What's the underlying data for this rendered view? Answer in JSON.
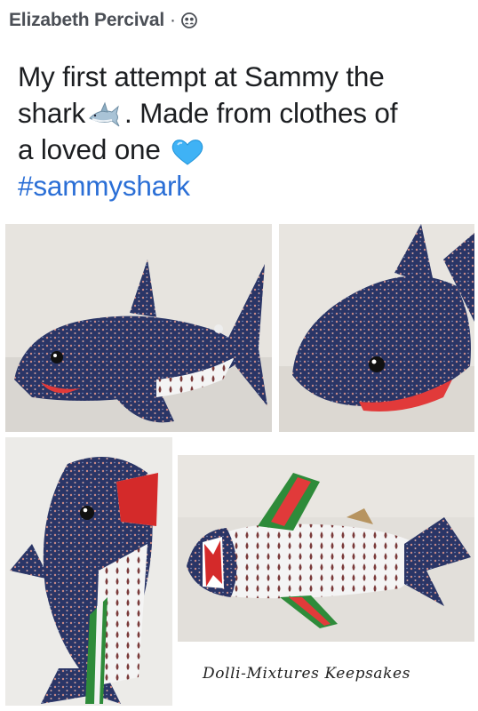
{
  "header": {
    "author": "Elizabeth Percival",
    "separator": "·",
    "audience_icon": "friends-icon"
  },
  "post": {
    "line1": "My first attempt at Sammy the",
    "line2_a": "shark",
    "line2_b": ". Made from clothes of",
    "line3": "a loved one",
    "hashtag": "#sammyshark",
    "emoji_shark": "shark-emoji",
    "emoji_heart": "blue-heart-emoji"
  },
  "photos": [
    {
      "subject": "shark-side-view"
    },
    {
      "subject": "shark-front-angle-view"
    },
    {
      "subject": "shark-vertical-view"
    },
    {
      "subject": "shark-belly-view"
    }
  ],
  "watermark": "Dolli-Mixtures Keepsakes",
  "colors": {
    "fabric_navy": "#2a3566",
    "hashtag_blue": "#2b6fd6",
    "heart_blue": "#3fb2f5"
  }
}
